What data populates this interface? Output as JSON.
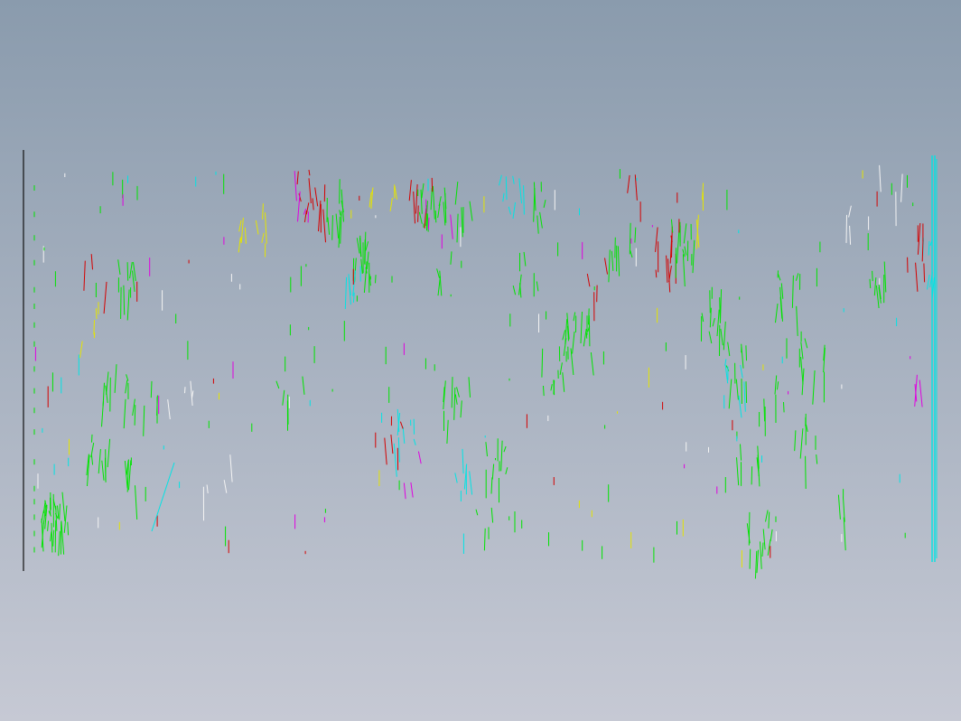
{
  "viewport": {
    "background_top": "#8a9bad",
    "background_bottom": "#c6c9d4"
  },
  "drawing": {
    "palette": {
      "green": "#00e400",
      "cyan": "#00e4e4",
      "red": "#d40000",
      "magenta": "#e000e0",
      "yellow": "#e4e400",
      "white": "#f4f4f4",
      "border": "#101010"
    }
  }
}
